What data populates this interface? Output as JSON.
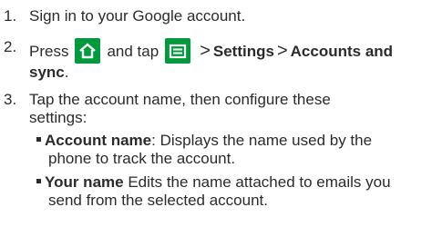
{
  "steps": [
    {
      "number": "1.",
      "text": "Sign in to your Google account."
    },
    {
      "number": "2.",
      "press": "Press",
      "and_tap": "and tap",
      "gt": ">",
      "settings": "Settings",
      "accounts": "Accounts and",
      "sync": "sync",
      "period": "."
    },
    {
      "number": "3.",
      "line1": "Tap the account name, then configure these",
      "line2": "settings:"
    }
  ],
  "icons": {
    "home": "home-icon",
    "menu": "menu-icon"
  },
  "bullets": [
    {
      "label": "Account name",
      "colon": ":",
      "text1": " Displays the name used by the",
      "text2": "phone to track the account."
    },
    {
      "label": "Your name",
      "text1": " Edits the name attached to emails you",
      "text2": "send from the selected account."
    }
  ],
  "colors": {
    "icon_background": "#009a3c",
    "text": "#2b2b2b"
  }
}
